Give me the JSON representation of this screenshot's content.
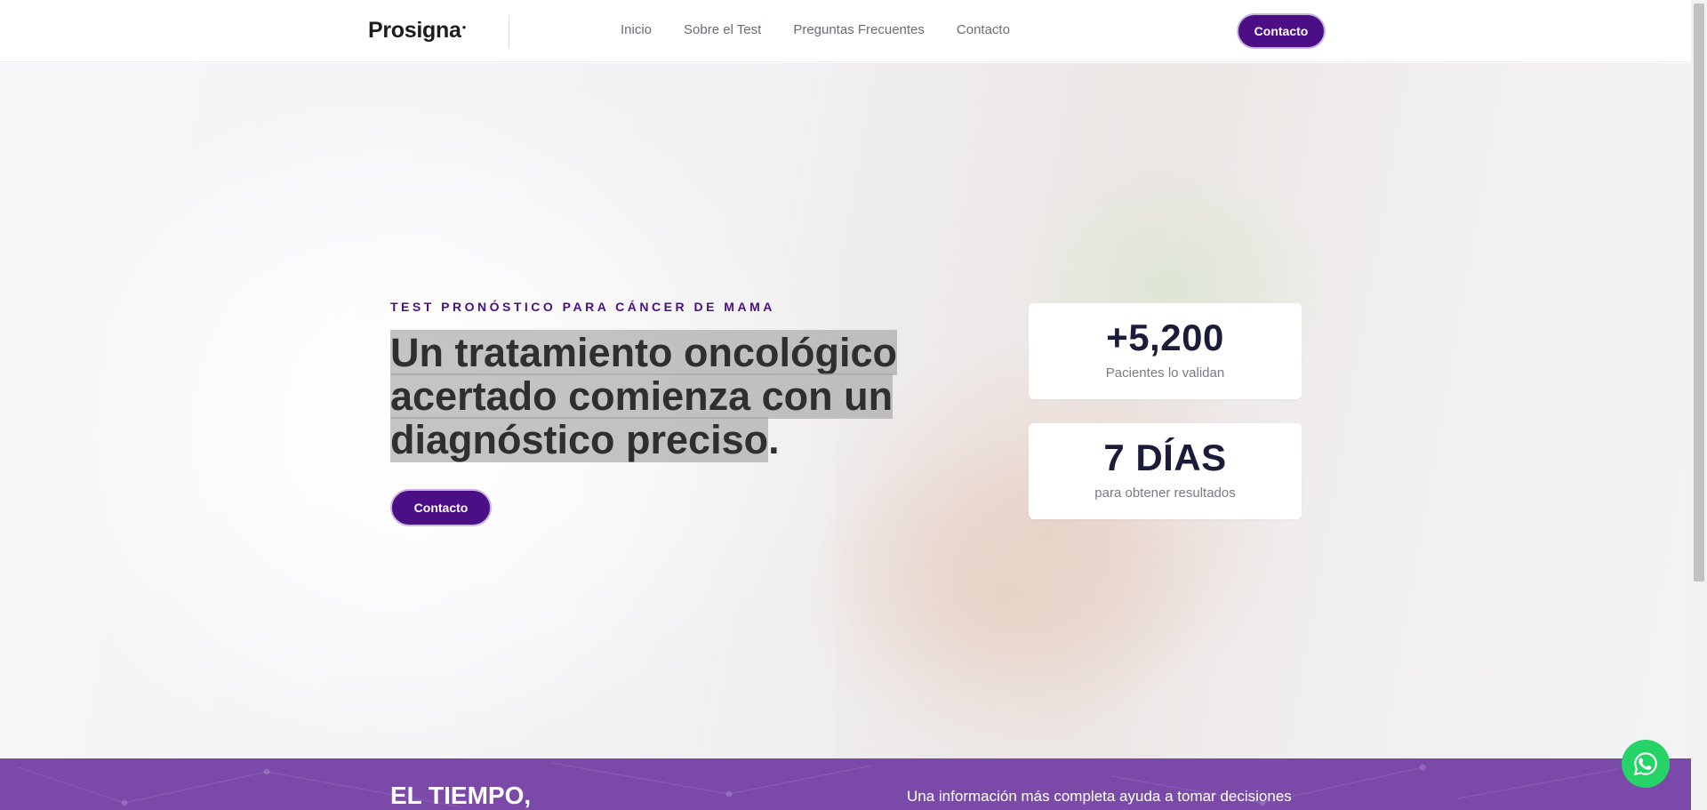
{
  "header": {
    "logo": "Prosigna",
    "nav": [
      "Inicio",
      "Sobre el Test",
      "Preguntas Frecuentes",
      "Contacto"
    ],
    "cta_label": "Contacto"
  },
  "hero": {
    "eyebrow": "TEST PRONÓSTICO PARA CÁNCER DE MAMA",
    "headline_line1": "Un tratamiento oncológico",
    "headline_line2": "acertado comienza con un",
    "headline_line3": "diagnóstico preciso",
    "headline_end": ".",
    "cta_label": "Contacto",
    "stats": [
      {
        "value": "+5,200",
        "label": "Pacientes lo validan"
      },
      {
        "value": "7 DÍAS",
        "label": "para obtener resultados"
      }
    ]
  },
  "band": {
    "title": "EL TIEMPO,",
    "text": "Una información más completa ayuda a tomar decisiones"
  },
  "icons": {
    "whatsapp": "whatsapp-icon"
  },
  "colors": {
    "brand": "#4b0e84",
    "band": "#7b4aa9",
    "whatsapp": "#25d366"
  }
}
